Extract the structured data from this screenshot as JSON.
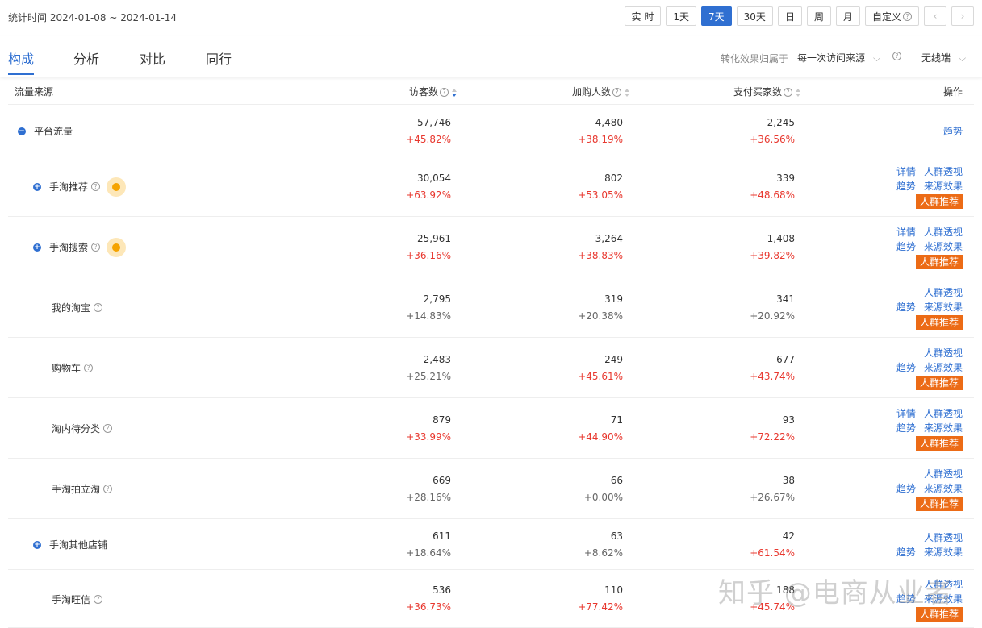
{
  "period": "统计时间 2024-01-08 ~ 2024-01-14",
  "time_buttons": [
    "实 时",
    "1天",
    "7天",
    "30天",
    "日",
    "周",
    "月",
    "自定义"
  ],
  "active_time": "7天",
  "tabs": [
    "构成",
    "分析",
    "对比",
    "同行"
  ],
  "attribution": {
    "label": "转化效果归属于",
    "value": "每一次访问来源"
  },
  "device": "无线端",
  "columns": {
    "source": "流量来源",
    "visitors": "访客数",
    "cart": "加购人数",
    "buyers": "支付买家数",
    "ops": "操作"
  },
  "rows": [
    {
      "name": "平台流量",
      "toggle": "−",
      "help": false,
      "dot": false,
      "visitors": "57,746",
      "visitors_chg": "+45.82%",
      "cart": "4,480",
      "cart_chg": "+38.19%",
      "buyers": "2,245",
      "buyers_chg": "+36.56%",
      "ops_line1": [
        "趋势"
      ],
      "ops_line2": [],
      "tag": ""
    },
    {
      "name": "手淘推荐",
      "toggle": "+",
      "help": true,
      "dot": true,
      "visitors": "30,054",
      "visitors_chg": "+63.92%",
      "cart": "802",
      "cart_chg": "+53.05%",
      "buyers": "339",
      "buyers_chg": "+48.68%",
      "ops_line1": [
        "详情",
        "人群透视"
      ],
      "ops_line2": [
        "趋势",
        "来源效果"
      ],
      "tag": "人群推荐"
    },
    {
      "name": "手淘搜索",
      "toggle": "+",
      "help": true,
      "dot": true,
      "visitors": "25,961",
      "visitors_chg": "+36.16%",
      "cart": "3,264",
      "cart_chg": "+38.83%",
      "buyers": "1,408",
      "buyers_chg": "+39.82%",
      "ops_line1": [
        "详情",
        "人群透视"
      ],
      "ops_line2": [
        "趋势",
        "来源效果"
      ],
      "tag": "人群推荐"
    },
    {
      "name": "我的淘宝",
      "toggle": "",
      "help": true,
      "dot": false,
      "visitors": "2,795",
      "visitors_chg": "+14.83%",
      "cart": "319",
      "cart_chg": "+20.38%",
      "buyers": "341",
      "buyers_chg": "+20.92%",
      "ops_line1": [
        "人群透视"
      ],
      "ops_line2": [
        "趋势",
        "来源效果"
      ],
      "tag": "人群推荐"
    },
    {
      "name": "购物车",
      "toggle": "",
      "help": true,
      "dot": false,
      "visitors": "2,483",
      "visitors_chg": "+25.21%",
      "cart": "249",
      "cart_chg": "+45.61%",
      "buyers": "677",
      "buyers_chg": "+43.74%",
      "ops_line1": [
        "人群透视"
      ],
      "ops_line2": [
        "趋势",
        "来源效果"
      ],
      "tag": "人群推荐"
    },
    {
      "name": "淘内待分类",
      "toggle": "",
      "help": true,
      "dot": false,
      "visitors": "879",
      "visitors_chg": "+33.99%",
      "cart": "71",
      "cart_chg": "+44.90%",
      "buyers": "93",
      "buyers_chg": "+72.22%",
      "ops_line1": [
        "详情",
        "人群透视"
      ],
      "ops_line2": [
        "趋势",
        "来源效果"
      ],
      "tag": "人群推荐"
    },
    {
      "name": "手淘拍立淘",
      "toggle": "",
      "help": true,
      "dot": false,
      "visitors": "669",
      "visitors_chg": "+28.16%",
      "cart": "66",
      "cart_chg": "+0.00%",
      "buyers": "38",
      "buyers_chg": "+26.67%",
      "ops_line1": [
        "人群透视"
      ],
      "ops_line2": [
        "趋势",
        "来源效果"
      ],
      "tag": "人群推荐"
    },
    {
      "name": "手淘其他店铺",
      "toggle": "+",
      "help": false,
      "dot": false,
      "visitors": "611",
      "visitors_chg": "+18.64%",
      "cart": "63",
      "cart_chg": "+8.62%",
      "buyers": "42",
      "buyers_chg": "+61.54%",
      "ops_line1": [
        "人群透视"
      ],
      "ops_line2": [
        "趋势",
        "来源效果"
      ],
      "tag": ""
    },
    {
      "name": "手淘旺信",
      "toggle": "",
      "help": true,
      "dot": false,
      "visitors": "536",
      "visitors_chg": "+36.73%",
      "cart": "110",
      "cart_chg": "+77.42%",
      "buyers": "188",
      "buyers_chg": "+45.74%",
      "ops_line1": [
        "人群透视"
      ],
      "ops_line2": [
        "趋势",
        "来源效果"
      ],
      "tag": "人群推荐"
    }
  ],
  "watermark": "知乎 @电商从业者",
  "colors": {
    "accent": "#2f6fd1",
    "increase": "#e8382f",
    "tag": "#ec6b16"
  }
}
